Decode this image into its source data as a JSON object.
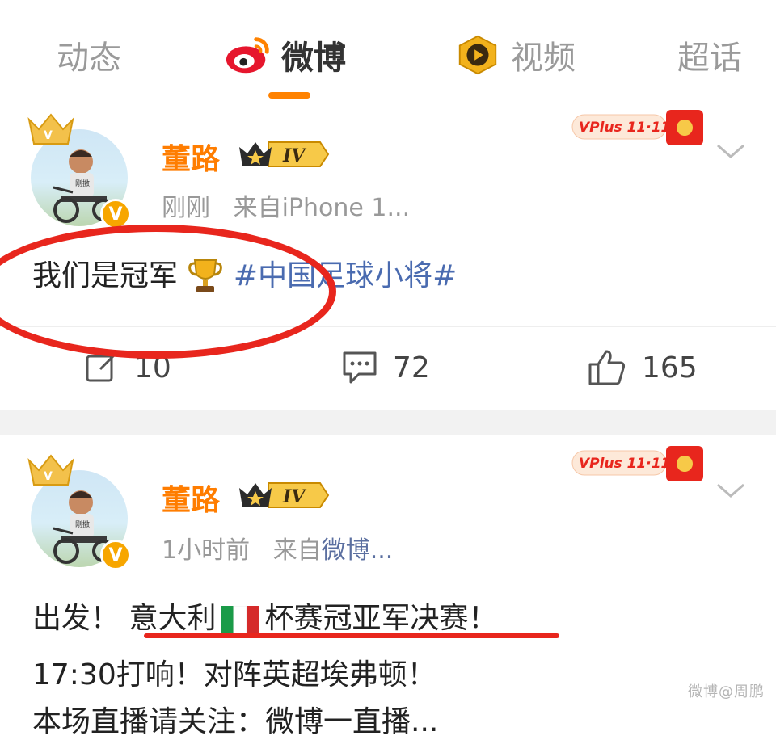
{
  "tabs": [
    {
      "label": "动态",
      "icon": "none"
    },
    {
      "label": "微博",
      "icon": "weibo-logo-icon",
      "active": true
    },
    {
      "label": "视频",
      "icon": "video-play-icon"
    },
    {
      "label": "超话",
      "icon": "none"
    }
  ],
  "posts": [
    {
      "username": "董路",
      "vip_level": "IV",
      "time": "刚刚",
      "source_prefix": "来自",
      "source": "iPhone 1...",
      "promo_label": "VPlus 11·11",
      "content_text": "我们是冠军",
      "content_emoji": "trophy-icon",
      "hashtag": "#中国足球小将#",
      "actions": {
        "repost": "10",
        "comment": "72",
        "like": "165"
      }
    },
    {
      "username": "董路",
      "vip_level": "IV",
      "time": "1小时前",
      "source_prefix": "来自",
      "source": "微博...",
      "promo_label": "VPlus 11·11",
      "line1_prefix": "出发！",
      "line1_highlight_a": "意大利",
      "line1_highlight_b": "杯赛冠亚军决赛！",
      "line2": "17:30打响！对阵英超埃弗顿！",
      "line3_partial": "本场直播请关注：微博一直播..."
    }
  ],
  "watermark": "微博@周鹏",
  "colors": {
    "accent": "#ff8200",
    "username": "#ff7d00",
    "hashtag": "#4a6bb0",
    "annotation": "#e8261d"
  }
}
